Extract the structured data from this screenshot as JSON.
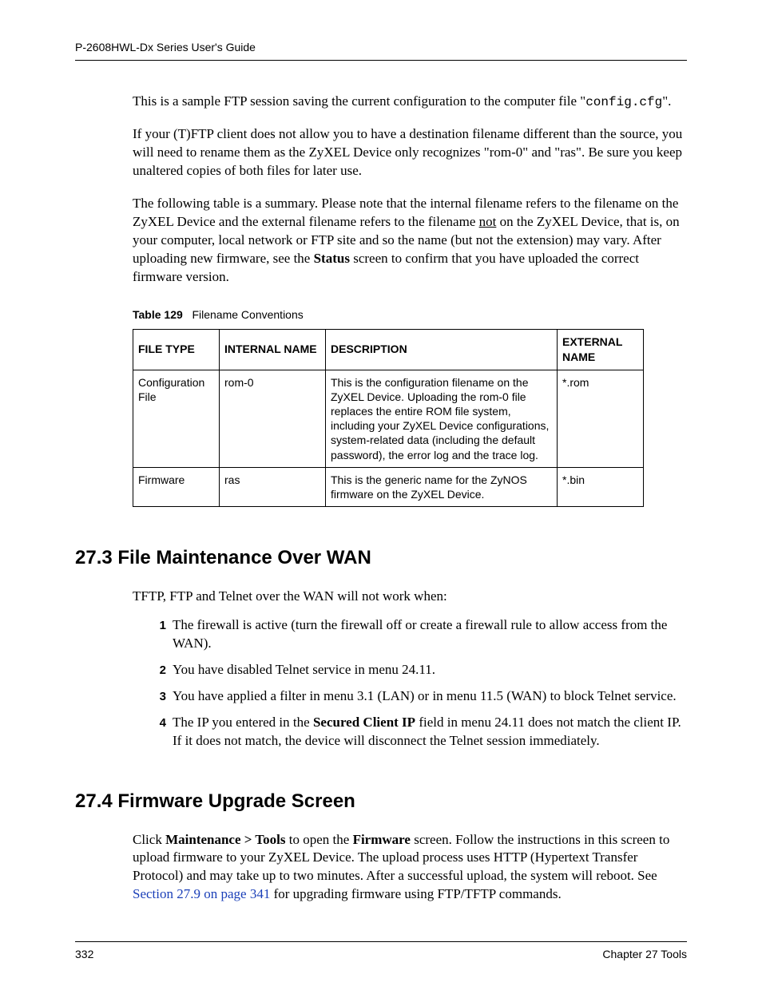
{
  "header": {
    "running": "P-2608HWL-Dx Series User's Guide"
  },
  "intro": {
    "p1a": "This is a sample FTP session saving the current configuration to the computer file \"",
    "p1code": "config.cfg",
    "p1b": "\".",
    "p2": "If your (T)FTP client does not allow you to have a destination filename different than the source, you will need to rename them as the ZyXEL Device only recognizes \"rom-0\" and \"ras\". Be sure you keep unaltered copies of both files for later use.",
    "p3a": "The following table is a summary. Please note that the internal filename refers to the filename on the ZyXEL Device and the external filename refers to the filename ",
    "p3u": "not",
    "p3b": " on the ZyXEL Device, that is, on your computer, local network or FTP site and so the name (but not the extension) may vary. After uploading new firmware, see the ",
    "p3bold": "Status",
    "p3c": " screen to confirm that you have uploaded the correct firmware version."
  },
  "table": {
    "caption_label": "Table 129",
    "caption_text": "Filename Conventions",
    "headers": {
      "c1": "FILE TYPE",
      "c2": "INTERNAL NAME",
      "c3": "DESCRIPTION",
      "c4": "EXTERNAL NAME"
    },
    "rows": [
      {
        "c1": "Configuration File",
        "c2": "rom-0",
        "c3": "This is the configuration filename on the ZyXEL Device. Uploading the rom-0 file replaces the entire ROM file system, including your ZyXEL Device configurations, system-related data (including the default password), the error log and the trace log.",
        "c4": "*.rom"
      },
      {
        "c1": "Firmware",
        "c2": "ras",
        "c3": "This is the generic name for the ZyNOS firmware on the ZyXEL Device.",
        "c4": "*.bin"
      }
    ]
  },
  "section273": {
    "heading": "27.3  File Maintenance Over WAN",
    "intro": "TFTP, FTP and Telnet over the WAN will not work when:",
    "items": [
      "The firewall is active (turn the firewall off or create a firewall rule to allow access from the WAN).",
      "You have disabled Telnet service in menu 24.11.",
      "You have applied a filter in menu 3.1 (LAN) or in menu 11.5 (WAN) to block Telnet service."
    ],
    "item4a": "The IP you entered in the ",
    "item4bold": "Secured Client IP",
    "item4b": " field in menu 24.11 does not match the client IP. If it does not match, the device will disconnect the Telnet session immediately."
  },
  "section274": {
    "heading": "27.4  Firmware Upgrade Screen",
    "p1a": "Click ",
    "p1b1": "Maintenance > Tools",
    "p1b": " to open the ",
    "p1b2": "Firmware",
    "p1c": " screen. Follow the instructions in this screen to upload firmware to your ZyXEL Device. The upload process uses HTTP (Hypertext Transfer Protocol) and may take up to two minutes. After a successful upload, the system will reboot. See ",
    "p1link": "Section 27.9 on page 341",
    "p1d": " for upgrading firmware using FTP/TFTP commands."
  },
  "footer": {
    "page_number": "332",
    "chapter": "Chapter 27 Tools"
  },
  "list_numbers": [
    "1",
    "2",
    "3",
    "4"
  ]
}
